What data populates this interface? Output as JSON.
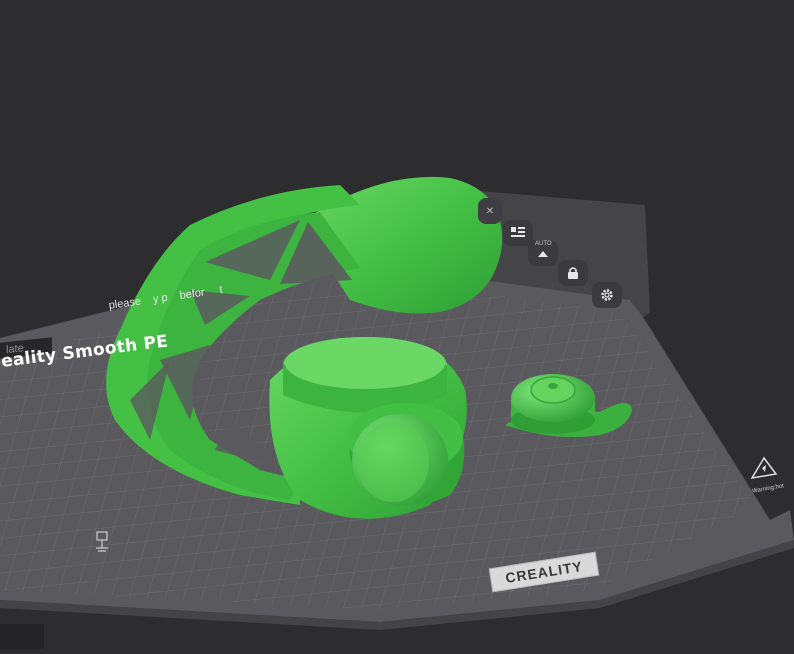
{
  "plate": {
    "tab_label": "late",
    "name": "eality Smooth PE",
    "hint": "please    y p    befor     t",
    "brand": "CREALITY",
    "warning": "Warning:hot"
  },
  "toolbar": {
    "auto_label": "AUTO",
    "items": [
      {
        "name": "close-icon"
      },
      {
        "name": "arrange-icon"
      },
      {
        "name": "auto-orient-icon"
      },
      {
        "name": "lock-icon"
      },
      {
        "name": "settings-icon"
      }
    ]
  },
  "colors": {
    "background": "#2d2d30",
    "plate": "#5c5c60",
    "grid": "#6e6e72",
    "model": "#4cc64c",
    "model_shadow": "#2f9e35",
    "model_highlight": "#73e06c"
  }
}
